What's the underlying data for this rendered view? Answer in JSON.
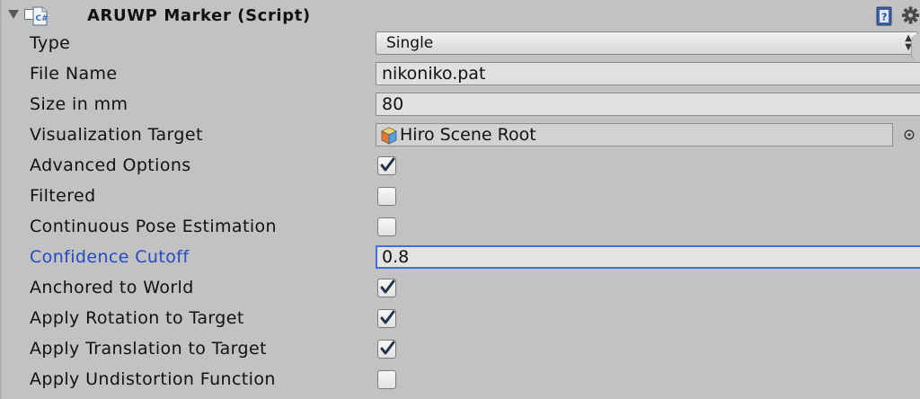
{
  "component": {
    "title": "ARUWP Marker (Script)",
    "enabled": true,
    "icons": [
      "foldout-triangle-icon",
      "script-icon",
      "help-book-icon",
      "gear-icon"
    ]
  },
  "fields": {
    "type": {
      "label": "Type",
      "value": "Single",
      "options_visible": [
        "Single"
      ]
    },
    "file_name": {
      "label": "File Name",
      "value": "nikoniko.pat"
    },
    "size_in_mm": {
      "label": "Size in mm",
      "value": "80"
    },
    "visualization_target": {
      "label": "Visualization Target",
      "value": "Hiro Scene Root",
      "icon": "gameobject-cube-icon"
    },
    "advanced_options": {
      "label": "Advanced Options",
      "checked": true
    },
    "filtered": {
      "label": "Filtered",
      "checked": false
    },
    "continuous_pose_estimation": {
      "label": "Continuous Pose Estimation",
      "checked": false
    },
    "confidence_cutoff": {
      "label": "Confidence Cutoff",
      "value": "0.8",
      "focused": true
    },
    "anchored_to_world": {
      "label": "Anchored to World",
      "checked": true
    },
    "apply_rotation_to_target": {
      "label": "Apply Rotation to Target",
      "checked": true
    },
    "apply_translation_to_target": {
      "label": "Apply Translation to Target",
      "checked": true
    },
    "apply_undistortion_function": {
      "label": "Apply Undistortion Function",
      "checked": false
    }
  },
  "colors": {
    "background": "#c2c2c2",
    "focused_label": "#2449c5",
    "focus_border": "#3f6fd7",
    "checkmark": "#23334a"
  }
}
